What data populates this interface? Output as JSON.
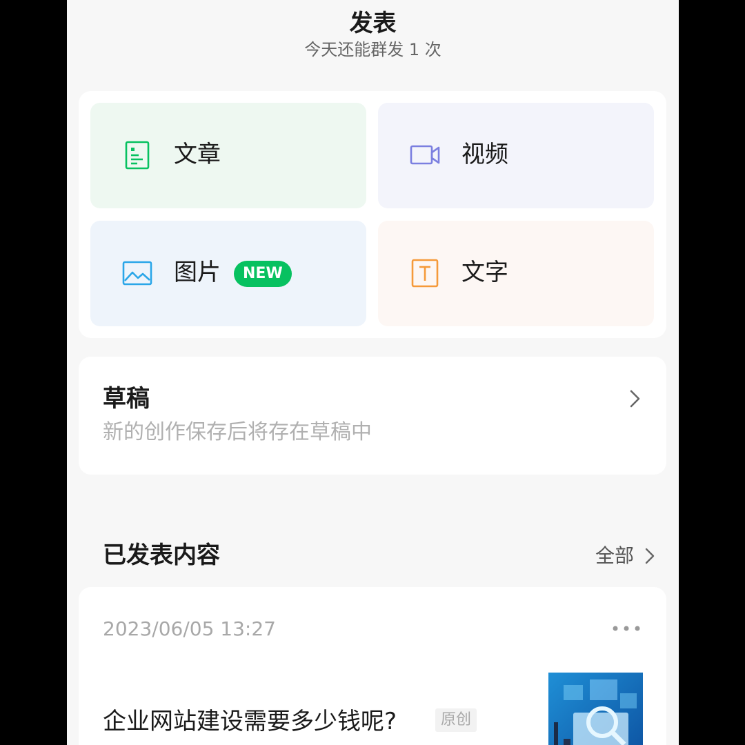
{
  "header": {
    "title": "发表",
    "subtitle": "今天还能群发 1 次"
  },
  "publish": {
    "tiles": [
      {
        "label": "文章",
        "icon": "article-icon",
        "color": "#07c160"
      },
      {
        "label": "视频",
        "icon": "video-icon",
        "color": "#7b7fe0"
      },
      {
        "label": "图片",
        "icon": "image-icon",
        "color": "#2aa6e8",
        "badge": "NEW"
      },
      {
        "label": "文字",
        "icon": "text-icon",
        "color": "#f59a3a"
      }
    ]
  },
  "draft": {
    "title": "草稿",
    "subtitle": "新的创作保存后将存在草稿中"
  },
  "published": {
    "title": "已发表内容",
    "all_label": "全部",
    "posts": [
      {
        "date": "2023/06/05 13:27",
        "title": "企业网站建设需要多少钱呢?",
        "tag": "原创"
      }
    ]
  },
  "colors": {
    "accent": "#07c160",
    "background": "#f7f7f7"
  }
}
